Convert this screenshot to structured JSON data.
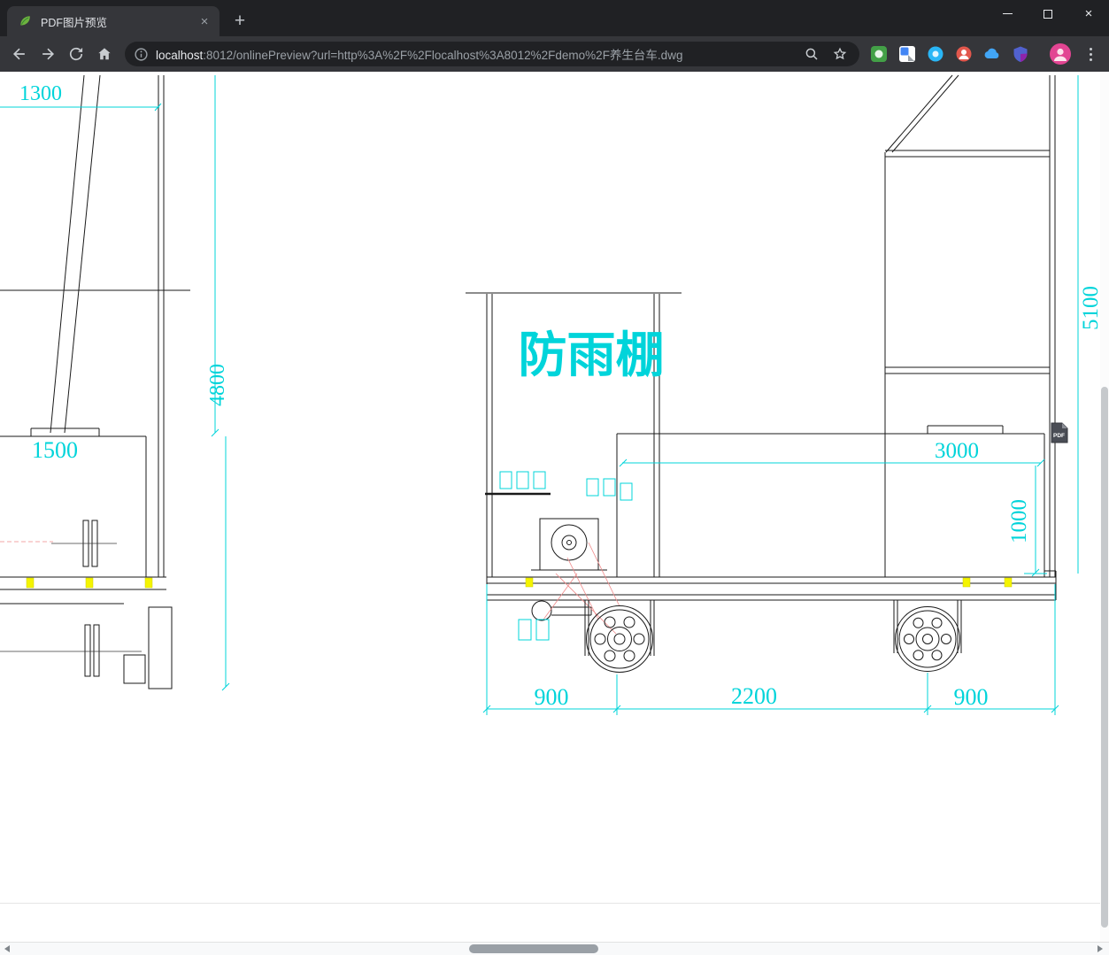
{
  "tab_bar": {
    "tab_title": "PDF图片预览"
  },
  "icons": {
    "close": "×",
    "plus": "+"
  },
  "toolbar": {
    "url_host": "localhost",
    "url_rest": ":8012/onlinePreview?url=http%3A%2F%2Flocalhost%3A8012%2Fdemo%2F养生台车.dwg"
  },
  "colors": {
    "chrome_frame": "#202124",
    "chrome_toolbar": "#35363a",
    "dimension_cyan": "#00d4da",
    "highlight_yellow": "#f4f400",
    "leader_pink": "#f08a8a",
    "favicon_green": "#6db33f"
  },
  "drawing": {
    "left_view": {
      "width_top": "1300",
      "height_total": "4800",
      "width_cap": "1500"
    },
    "main_view": {
      "canopy_label": "防雨棚",
      "height_total": "5100",
      "box_width": "3000",
      "box_height": "1000",
      "front_overhang": "900",
      "wheelbase": "2200",
      "rear_overhang": "900"
    },
    "pdf_badge_label": "PDF"
  }
}
